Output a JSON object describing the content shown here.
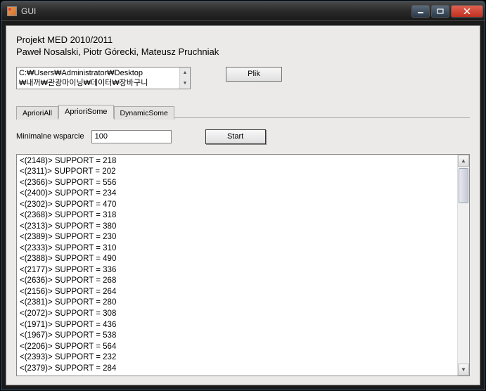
{
  "window": {
    "title": "GUI"
  },
  "header": {
    "line1": "Projekt MED 2010/2011",
    "line2": "Paweł Nosalski, Piotr Górecki, Mateusz Pruchniak"
  },
  "file": {
    "path_line1": "C:₩Users₩Administrator₩Desktop",
    "path_line2": "₩내꺼₩관광마이닝₩데이터₩장바구니",
    "button_label": "Plik"
  },
  "tabs": {
    "items": [
      "AprioriAll",
      "AprioriSome",
      "DynamicSome"
    ],
    "active_index": 1
  },
  "params": {
    "label": "Minimalne wsparcie",
    "value": "100",
    "start_label": "Start"
  },
  "results": {
    "lines": [
      "<(2148)> SUPPORT = 218",
      "<(2311)> SUPPORT = 202",
      "<(2366)> SUPPORT = 556",
      "<(2400)> SUPPORT = 234",
      "<(2302)> SUPPORT = 470",
      "<(2368)> SUPPORT = 318",
      "<(2313)> SUPPORT = 380",
      "<(2389)> SUPPORT = 230",
      "<(2333)> SUPPORT = 310",
      "<(2388)> SUPPORT = 490",
      "<(2177)> SUPPORT = 336",
      "<(2636)> SUPPORT = 268",
      "<(2156)> SUPPORT = 264",
      "<(2381)> SUPPORT = 280",
      "<(2072)> SUPPORT = 308",
      "<(1971)> SUPPORT = 436",
      "<(1967)> SUPPORT = 538",
      "<(2206)> SUPPORT = 564",
      "<(2393)> SUPPORT = 232",
      "<(2379)> SUPPORT = 284"
    ]
  }
}
